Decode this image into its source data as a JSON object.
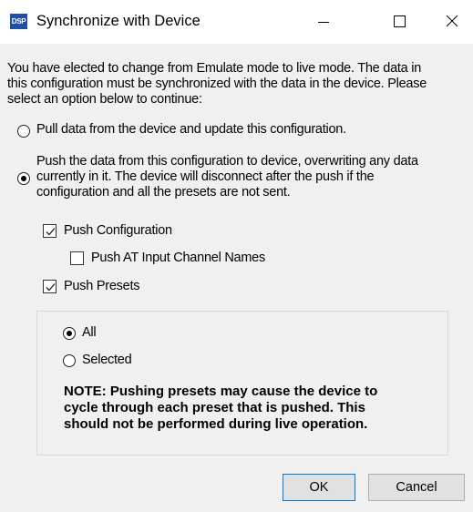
{
  "window": {
    "title": "Synchronize with Device",
    "app_icon_text": "DSP",
    "minimize_icon": "minimize-icon",
    "maximize_icon": "maximize-icon",
    "close_icon": "close-icon"
  },
  "message": {
    "line1": "You have elected to change from Emulate mode to live mode. The data in",
    "line2": "this configuration must be synchronized with the data in the device. Please",
    "line3": "select an option below to continue:"
  },
  "options": {
    "pull": {
      "label": "Pull data from the device and update this configuration.",
      "selected": false
    },
    "push": {
      "line1": "Push the data from this configuration to device, overwriting any data",
      "line2": "currently in it. The device will disconnect after the push if the",
      "line3": "configuration and all the presets are not sent.",
      "selected": true
    }
  },
  "push_options": {
    "push_configuration": {
      "label": "Push Configuration",
      "checked": true
    },
    "push_at_input_channel_names": {
      "label": "Push AT Input Channel Names",
      "checked": false
    },
    "push_presets": {
      "label": "Push Presets",
      "checked": true
    }
  },
  "presets": {
    "all": {
      "label": "All",
      "selected": true
    },
    "selected": {
      "label": "Selected",
      "selected": false
    },
    "note": {
      "line1": "NOTE: Pushing presets may cause the device to",
      "line2": "cycle through each preset that is pushed. This",
      "line3": "should not be performed during live operation."
    }
  },
  "buttons": {
    "ok": "OK",
    "cancel": "Cancel"
  },
  "colors": {
    "accent": "#0078d7",
    "icon_bg": "#1f4fa6",
    "dialog_bg": "#f0f0f0",
    "titlebar_bg": "#ffffff"
  }
}
